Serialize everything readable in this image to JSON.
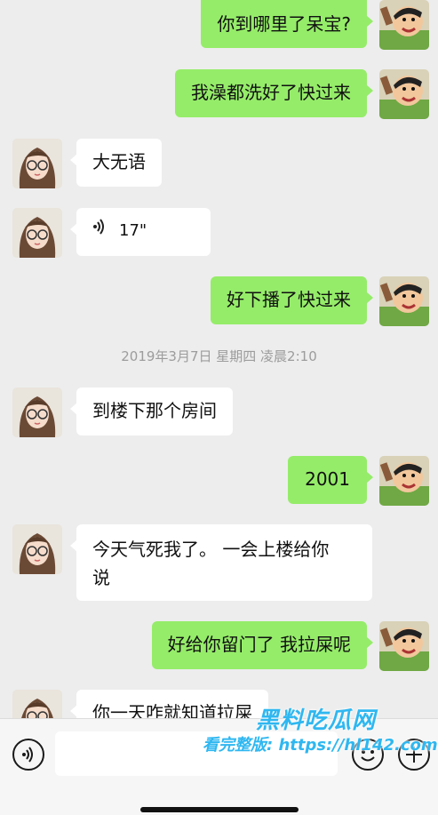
{
  "messages": [
    {
      "from": "me",
      "text": "你到哪里了呆宝?"
    },
    {
      "from": "me",
      "text": "我澡都洗好了快过来"
    },
    {
      "from": "her",
      "text": "大无语"
    },
    {
      "from": "her",
      "type": "voice",
      "duration": "17\""
    },
    {
      "from": "me",
      "text": "好下播了快过来"
    },
    {
      "from": "me",
      "text": "2001"
    },
    {
      "from": "her",
      "text": "到楼下那个房间"
    },
    {
      "from": "her",
      "text": "今天气死我了。 一会上楼给你说"
    },
    {
      "from": "me",
      "text": "好给你留门了 我拉屎呢"
    },
    {
      "from": "her",
      "text": "你一天咋就知道拉屎"
    }
  ],
  "timestamp": "2019年3月7日 星期四 凌晨2:10",
  "her_line1": "今天气死我了。 一会上楼给你",
  "her_line2": "说",
  "watermark": {
    "brand": "黑料吃瓜网",
    "url": "看完整版: https://hl142.com"
  },
  "colors": {
    "my_bubble": "#95ec69",
    "her_bubble": "#ffffff",
    "background": "#ededed"
  }
}
